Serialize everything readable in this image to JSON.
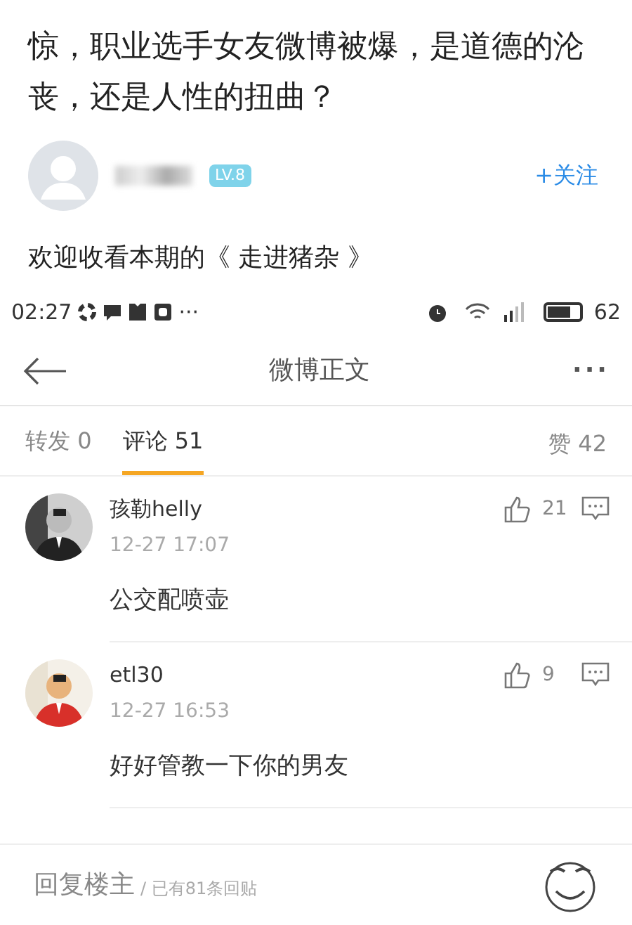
{
  "headline": "惊，职业选手女友微博被爆，是道德的沦丧，还是人性的扭曲？",
  "author": {
    "level_badge": "LV.8",
    "follow": "+关注"
  },
  "intro": "欢迎收看本期的《 走进猪杂 》",
  "status_bar": {
    "time": "02:27",
    "more": "···",
    "battery": "62"
  },
  "nav": {
    "title": "微博正文",
    "more": "···"
  },
  "tabs": [
    {
      "label": "转发 0",
      "selected": false
    },
    {
      "label": "评论 51",
      "selected": true
    }
  ],
  "likes_tab": "赞 42",
  "comments": [
    {
      "user": "孩勒helly",
      "time": "12-27 17:07",
      "likes": "21",
      "text": "公交配喷壶"
    },
    {
      "user": "etl30",
      "time": "12-27 16:53",
      "likes": "9",
      "text": "好好管教一下你的男友"
    }
  ],
  "reply_bar": {
    "label": "回复楼主",
    "count": "/ 已有81条回贴"
  }
}
